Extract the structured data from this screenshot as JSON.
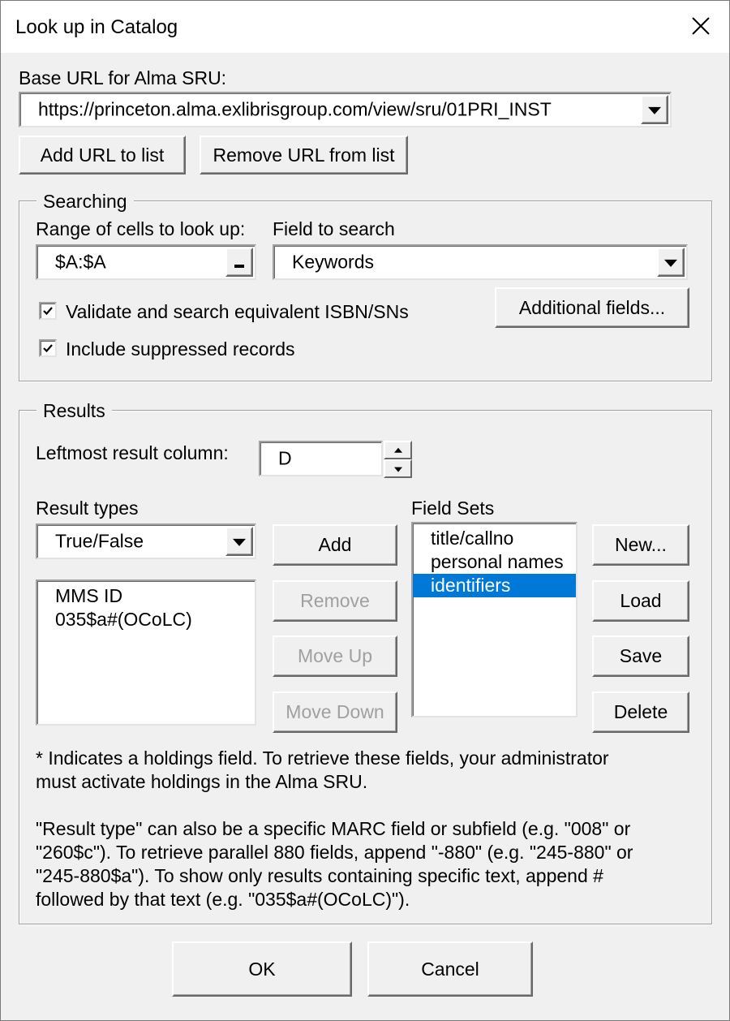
{
  "window": {
    "title": "Look up in Catalog"
  },
  "base_url": {
    "label": "Base URL for Alma SRU:",
    "value": "https://princeton.alma.exlibrisgroup.com/view/sru/01PRI_INST",
    "add_button": "Add URL to list",
    "remove_button": "Remove URL from list"
  },
  "searching": {
    "group_label": "Searching",
    "range_label": "Range of cells to look up:",
    "range_value": "$A:$A",
    "field_label": "Field to search",
    "field_value": "Keywords",
    "validate_label": "Validate and search equivalent ISBN/SNs",
    "validate_checked": true,
    "suppressed_label": "Include suppressed records",
    "suppressed_checked": true,
    "additional_button": "Additional fields..."
  },
  "results": {
    "group_label": "Results",
    "leftmost_label": "Leftmost result column:",
    "leftmost_value": "D",
    "result_types_label": "Result types",
    "result_type_value": "True/False",
    "result_list": [
      "MMS ID",
      "035$a#(OCoLC)"
    ],
    "add_button": "Add",
    "remove_button": "Remove",
    "move_up_button": "Move Up",
    "move_down_button": "Move Down",
    "field_sets_label": "Field Sets",
    "field_sets": [
      "title/callno",
      "personal names",
      "identifiers"
    ],
    "selected_field_set": "identifiers",
    "new_button": "New...",
    "load_button": "Load",
    "save_button": "Save",
    "delete_button": "Delete",
    "note1_line1": "* Indicates a holdings field.  To retrieve these fields, your administrator",
    "note1_line2": "must activate holdings in the Alma SRU.",
    "note2_line1": "\"Result type\" can also be a specific MARC field or subfield (e.g. \"008\" or",
    "note2_line2": "\"260$c\").  To retrieve parallel 880 fields, append \"-880\" (e.g. \"245-880\" or",
    "note2_line3": "\"245-880$a\"). To show only results containing specific text, append #",
    "note2_line4": "followed by that text (e.g. \"035$a#(OCoLC)\")."
  },
  "footer": {
    "ok_button": "OK",
    "cancel_button": "Cancel"
  },
  "colors": {
    "dialog_bg": "#f0f0f0",
    "selection": "#0078d7",
    "disabled_text": "#a0a0a0"
  }
}
